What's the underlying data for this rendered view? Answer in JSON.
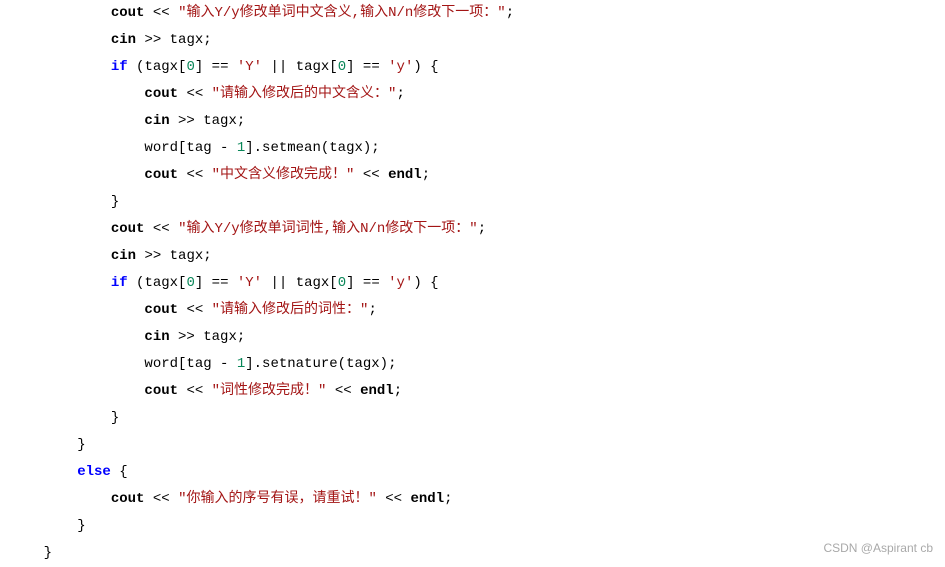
{
  "code": {
    "lines": [
      {
        "indent": 4,
        "segments": [
          {
            "t": "cout ",
            "c": "bold"
          },
          {
            "t": "<<",
            "c": ""
          },
          {
            "t": " ",
            "c": ""
          },
          {
            "t": "\"输入Y/y修改单词中文含义,输入N/n修改下一项：\"",
            "c": "str"
          },
          {
            "t": ";",
            "c": ""
          }
        ]
      },
      {
        "indent": 4,
        "segments": [
          {
            "t": "cin ",
            "c": "bold"
          },
          {
            "t": ">>",
            "c": ""
          },
          {
            "t": " tagx;",
            "c": ""
          }
        ]
      },
      {
        "indent": 4,
        "segments": [
          {
            "t": "if",
            "c": "kw"
          },
          {
            "t": " (tagx[",
            "c": ""
          },
          {
            "t": "0",
            "c": "num"
          },
          {
            "t": "] == ",
            "c": ""
          },
          {
            "t": "'Y'",
            "c": "str"
          },
          {
            "t": " || tagx[",
            "c": ""
          },
          {
            "t": "0",
            "c": "num"
          },
          {
            "t": "] == ",
            "c": ""
          },
          {
            "t": "'y'",
            "c": "str"
          },
          {
            "t": ") {",
            "c": ""
          }
        ]
      },
      {
        "indent": 5,
        "segments": [
          {
            "t": "cout ",
            "c": "bold"
          },
          {
            "t": "<<",
            "c": ""
          },
          {
            "t": " ",
            "c": ""
          },
          {
            "t": "\"请输入修改后的中文含义：\"",
            "c": "str"
          },
          {
            "t": ";",
            "c": ""
          }
        ]
      },
      {
        "indent": 5,
        "segments": [
          {
            "t": "cin ",
            "c": "bold"
          },
          {
            "t": ">>",
            "c": ""
          },
          {
            "t": " tagx;",
            "c": ""
          }
        ]
      },
      {
        "indent": 5,
        "segments": [
          {
            "t": "word[tag - ",
            "c": ""
          },
          {
            "t": "1",
            "c": "num"
          },
          {
            "t": "].setmean(tagx);",
            "c": ""
          }
        ]
      },
      {
        "indent": 5,
        "segments": [
          {
            "t": "cout ",
            "c": "bold"
          },
          {
            "t": "<<",
            "c": ""
          },
          {
            "t": " ",
            "c": ""
          },
          {
            "t": "\"中文含义修改完成！\"",
            "c": "str"
          },
          {
            "t": " ",
            "c": ""
          },
          {
            "t": "<<",
            "c": ""
          },
          {
            "t": " ",
            "c": ""
          },
          {
            "t": "endl",
            "c": "bold"
          },
          {
            "t": ";",
            "c": ""
          }
        ]
      },
      {
        "indent": 4,
        "segments": [
          {
            "t": "}",
            "c": ""
          }
        ]
      },
      {
        "indent": 4,
        "segments": [
          {
            "t": "cout ",
            "c": "bold"
          },
          {
            "t": "<<",
            "c": ""
          },
          {
            "t": " ",
            "c": ""
          },
          {
            "t": "\"输入Y/y修改单词词性,输入N/n修改下一项：\"",
            "c": "str"
          },
          {
            "t": ";",
            "c": ""
          }
        ]
      },
      {
        "indent": 4,
        "segments": [
          {
            "t": "cin ",
            "c": "bold"
          },
          {
            "t": ">>",
            "c": ""
          },
          {
            "t": " tagx;",
            "c": ""
          }
        ]
      },
      {
        "indent": 4,
        "segments": [
          {
            "t": "if",
            "c": "kw"
          },
          {
            "t": " (tagx[",
            "c": ""
          },
          {
            "t": "0",
            "c": "num"
          },
          {
            "t": "] == ",
            "c": ""
          },
          {
            "t": "'Y'",
            "c": "str"
          },
          {
            "t": " || tagx[",
            "c": ""
          },
          {
            "t": "0",
            "c": "num"
          },
          {
            "t": "] == ",
            "c": ""
          },
          {
            "t": "'y'",
            "c": "str"
          },
          {
            "t": ") {",
            "c": ""
          }
        ]
      },
      {
        "indent": 5,
        "segments": [
          {
            "t": "cout ",
            "c": "bold"
          },
          {
            "t": "<<",
            "c": ""
          },
          {
            "t": " ",
            "c": ""
          },
          {
            "t": "\"请输入修改后的词性：\"",
            "c": "str"
          },
          {
            "t": ";",
            "c": ""
          }
        ]
      },
      {
        "indent": 5,
        "segments": [
          {
            "t": "cin ",
            "c": "bold"
          },
          {
            "t": ">>",
            "c": ""
          },
          {
            "t": " tagx;",
            "c": ""
          }
        ]
      },
      {
        "indent": 5,
        "segments": [
          {
            "t": "word[tag - ",
            "c": ""
          },
          {
            "t": "1",
            "c": "num"
          },
          {
            "t": "].setnature(tagx);",
            "c": ""
          }
        ]
      },
      {
        "indent": 5,
        "segments": [
          {
            "t": "cout ",
            "c": "bold"
          },
          {
            "t": "<<",
            "c": ""
          },
          {
            "t": " ",
            "c": ""
          },
          {
            "t": "\"词性修改完成！\"",
            "c": "str"
          },
          {
            "t": " ",
            "c": ""
          },
          {
            "t": "<<",
            "c": ""
          },
          {
            "t": " ",
            "c": ""
          },
          {
            "t": "endl",
            "c": "bold"
          },
          {
            "t": ";",
            "c": ""
          }
        ]
      },
      {
        "indent": 4,
        "segments": [
          {
            "t": "}",
            "c": ""
          }
        ]
      },
      {
        "indent": 3,
        "segments": [
          {
            "t": "}",
            "c": ""
          }
        ]
      },
      {
        "indent": 3,
        "segments": [
          {
            "t": "else",
            "c": "kw"
          },
          {
            "t": " {",
            "c": ""
          }
        ]
      },
      {
        "indent": 4,
        "segments": [
          {
            "t": "cout ",
            "c": "bold"
          },
          {
            "t": "<<",
            "c": ""
          },
          {
            "t": " ",
            "c": ""
          },
          {
            "t": "\"你输入的序号有误，请重试！\"",
            "c": "str"
          },
          {
            "t": " ",
            "c": ""
          },
          {
            "t": "<<",
            "c": ""
          },
          {
            "t": " ",
            "c": ""
          },
          {
            "t": "endl",
            "c": "bold"
          },
          {
            "t": ";",
            "c": ""
          }
        ]
      },
      {
        "indent": 3,
        "segments": [
          {
            "t": "}",
            "c": ""
          }
        ]
      },
      {
        "indent": 2,
        "segments": [
          {
            "t": "}",
            "c": ""
          }
        ]
      }
    ]
  },
  "watermark": "CSDN @Aspirant cb"
}
